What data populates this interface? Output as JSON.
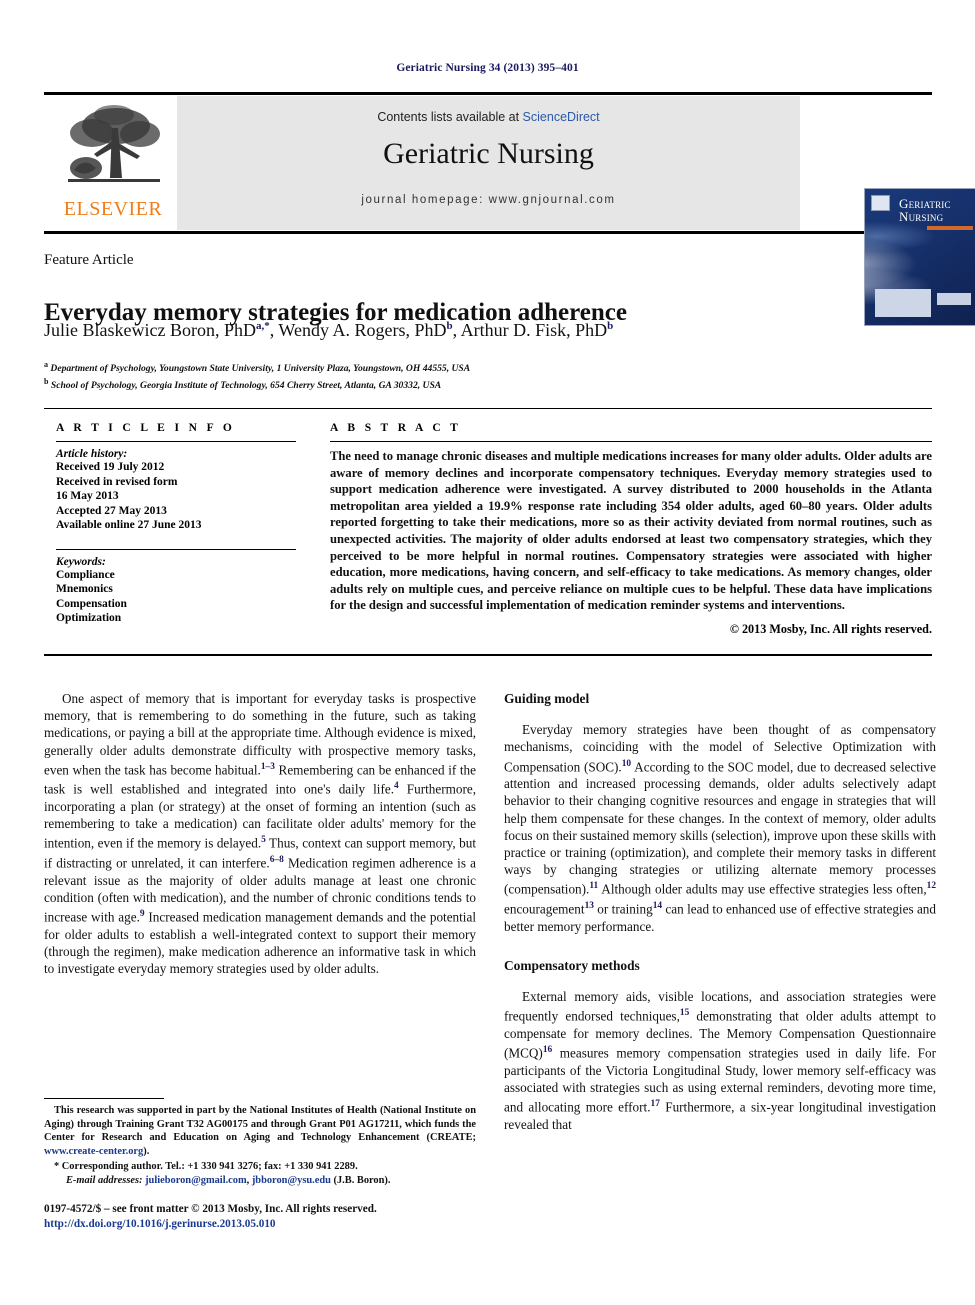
{
  "running_head": "Geriatric Nursing 34 (2013) 395–401",
  "masthead": {
    "contents_prefix": "Contents lists available at ",
    "sciencedirect": "ScienceDirect",
    "journal_name": "Geriatric Nursing",
    "homepage": "journal homepage: www.gnjournal.com",
    "publisher_logo_text": "ELSEVIER",
    "cover_title_line1": "Geriatric",
    "cover_title_line2": "Nursing",
    "accent_blue": "#2b59a8",
    "elsevier_orange": "#f07d1a",
    "cover_navy": "#16306b"
  },
  "article": {
    "type_label": "Feature Article",
    "title": "Everyday memory strategies for medication adherence",
    "authors_html": "Julie Blaskewicz Boron, PhD<sup>a,*</sup>, Wendy A. Rogers, PhD<sup>b</sup>, Arthur D. Fisk, PhD<sup>b</sup>",
    "affiliation_a": "Department of Psychology, Youngstown State University, 1 University Plaza, Youngstown, OH 44555, USA",
    "affiliation_b": "School of Psychology, Georgia Institute of Technology, 654 Cherry Street, Atlanta, GA 30332, USA"
  },
  "article_info": {
    "heading": "A R T I C L E   I N F O",
    "history_label": "Article history:",
    "history": [
      "Received 19 July 2012",
      "Received in revised form",
      "16 May 2013",
      "Accepted 27 May 2013",
      "Available online 27 June 2013"
    ],
    "keywords_label": "Keywords:",
    "keywords": [
      "Compliance",
      "Mnemonics",
      "Compensation",
      "Optimization"
    ]
  },
  "abstract": {
    "heading": "A B S T R A C T",
    "text": "The need to manage chronic diseases and multiple medications increases for many older adults. Older adults are aware of memory declines and incorporate compensatory techniques. Everyday memory strategies used to support medication adherence were investigated. A survey distributed to 2000 households in the Atlanta metropolitan area yielded a 19.9% response rate including 354 older adults, aged 60–80 years. Older adults reported forgetting to take their medications, more so as their activity deviated from normal routines, such as unexpected activities. The majority of older adults endorsed at least two compensatory strategies, which they perceived to be more helpful in normal routines. Compensatory strategies were associated with higher education, more medications, having concern, and self-efficacy to take medications. As memory changes, older adults rely on multiple cues, and perceive reliance on multiple cues to be helpful. These data have implications for the design and successful implementation of medication reminder systems and interventions.",
    "copyright": "© 2013 Mosby, Inc. All rights reserved."
  },
  "body": {
    "left_paragraph_html": "One aspect of memory that is important for everyday tasks is prospective memory, that is remembering to do something in the future, such as taking medications, or paying a bill at the appropriate time. Although evidence is mixed, generally older adults demonstrate difficulty with prospective memory tasks, even when the task has become habitual.<sup class=\"cit\">1–3</sup> Remembering can be enhanced if the task is well established and integrated into one's daily life.<sup class=\"cit\">4</sup> Furthermore, incorporating a plan (or strategy) at the onset of forming an intention (such as remembering to take a medication) can facilitate older adults' memory for the intention, even if the memory is delayed.<sup class=\"cit\">5</sup> Thus, context can support memory, but if distracting or unrelated, it can interfere.<sup class=\"cit\">6–8</sup> Medication regimen adherence is a relevant issue as the majority of older adults manage at least one chronic condition (often with medication), and the number of chronic conditions tends to increase with age.<sup class=\"cit\">9</sup> Increased medication management demands and the potential for older adults to establish a well-integrated context to support their memory (through the regimen), make medication adherence an informative task in which to investigate everyday memory strategies used by older adults.",
    "section_guiding_model": "Guiding model",
    "guiding_model_paragraph_html": "Everyday memory strategies have been thought of as compensatory mechanisms, coinciding with the model of Selective Optimization with Compensation (SOC).<sup class=\"cit\">10</sup> According to the SOC model, due to decreased selective attention and increased processing demands, older adults selectively adapt behavior to their changing cognitive resources and engage in strategies that will help them compensate for these changes. In the context of memory, older adults focus on their sustained memory skills (selection), improve upon these skills with practice or training (optimization), and complete their memory tasks in different ways by changing strategies or utilizing alternate memory processes (compensation).<sup class=\"cit\">11</sup> Although older adults may use effective strategies less often,<sup class=\"cit\">12</sup> encouragement<sup class=\"cit\">13</sup> or training<sup class=\"cit\">14</sup> can lead to enhanced use of effective strategies and better memory performance.",
    "section_compensatory_methods": "Compensatory methods",
    "compensatory_methods_paragraph_html": "External memory aids, visible locations, and association strategies were frequently endorsed techniques,<sup class=\"cit\">15</sup> demonstrating that older adults attempt to compensate for memory declines. The Memory Compensation Questionnaire (MCQ)<sup class=\"cit\">16</sup> measures memory compensation strategies used in daily life. For participants of the Victoria Longitudinal Study, lower memory self-efficacy was associated with strategies such as using external reminders, devoting more time, and allocating more effort.<sup class=\"cit\">17</sup> Furthermore, a six-year longitudinal investigation revealed that"
  },
  "footnotes": {
    "funding_html": "This research was supported in part by the National Institutes of Health (National Institute on Aging) through Training Grant T32 AG00175 and through Grant P01 AG17211, which funds the Center for Research and Education on Aging and Technology Enhancement (CREATE; <span class=\"lnk\">www.create-center.org</span>).",
    "corresponding_html": "* Corresponding author. Tel.: +1 330 941 3276; fax: +1 330 941 2289.",
    "email_html": "<span class=\"ital\">E-mail addresses:</span> <span class=\"lnk\">julieboron@gmail.com</span>, <span class=\"lnk\">jbboron@ysu.edu</span> (J.B. Boron)."
  },
  "colophon": {
    "issn_line": "0197-4572/$ – see front matter © 2013 Mosby, Inc. All rights reserved.",
    "doi": "http://dx.doi.org/10.1016/j.gerinurse.2013.05.010"
  }
}
